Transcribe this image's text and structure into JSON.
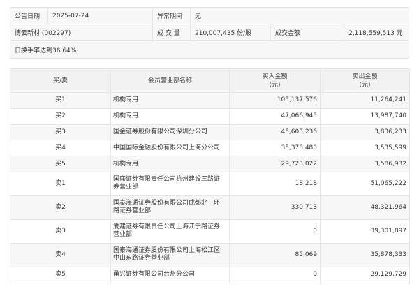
{
  "info": {
    "date_label": "公告日期",
    "date_value": "2025-07-24",
    "period_label": "异常期间",
    "period_value": "无",
    "stock": "博云新材 (002297)",
    "volume_label": "成 交 量",
    "volume_value": "210,007,435 份/股",
    "amount_label": "成交金额",
    "amount_value": "2,118,559,513 元",
    "reason": "日换手率达到36.64%"
  },
  "table": {
    "headers": {
      "type": "买/卖",
      "dept": "会员营业部名称",
      "buy": "买入金额",
      "buy_unit": "(元)",
      "sell": "卖出金额",
      "sell_unit": "(元)"
    },
    "rows": [
      {
        "type": "买1",
        "dept": "机构专用",
        "buy": "105,137,576",
        "sell": "11,264,241"
      },
      {
        "type": "买2",
        "dept": "机构专用",
        "buy": "47,066,945",
        "sell": "13,987,740"
      },
      {
        "type": "买3",
        "dept": "国金证券股份有限公司深圳分公司",
        "buy": "45,603,236",
        "sell": "3,836,233"
      },
      {
        "type": "买4",
        "dept": "中国国际金融股份有限公司上海分公司",
        "buy": "35,378,480",
        "sell": "3,535,599"
      },
      {
        "type": "买5",
        "dept": "机构专用",
        "buy": "29,723,022",
        "sell": "3,586,932"
      },
      {
        "type": "卖1",
        "dept": "国盛证券有限责任公司杭州建设三路证券营业部",
        "buy": "18,218",
        "sell": "51,065,222"
      },
      {
        "type": "卖2",
        "dept": "国泰海通证券股份有限公司成都北一环路证券营业部",
        "buy": "330,713",
        "sell": "48,321,964"
      },
      {
        "type": "卖3",
        "dept": "爱建证券有限责任公司上海江宁路证券营业部",
        "buy": "0",
        "sell": "39,301,897"
      },
      {
        "type": "卖4",
        "dept": "国泰海通证券股份有限公司上海松江区中山东路证券营业部",
        "buy": "85,069",
        "sell": "35,878,333"
      },
      {
        "type": "卖5",
        "dept": "甬兴证券有限公司台州分公司",
        "buy": "0",
        "sell": "29,129,729"
      }
    ]
  }
}
